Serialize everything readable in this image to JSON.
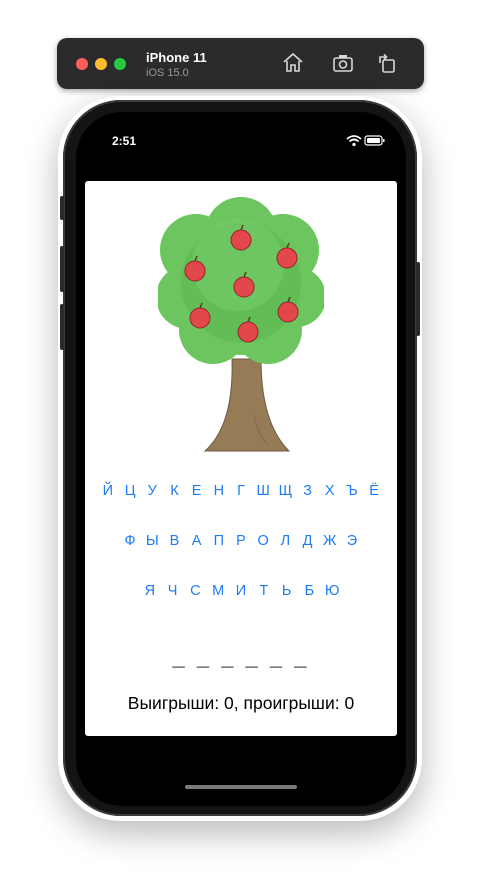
{
  "simulator": {
    "device_name": "iPhone 11",
    "os_version": "iOS 15.0",
    "controls": [
      "home-icon",
      "screenshot-icon",
      "rotate-icon"
    ]
  },
  "status_bar": {
    "time": "2:51",
    "icons": [
      "wifi-icon",
      "battery-icon"
    ]
  },
  "game": {
    "keyboard": {
      "row1": [
        "Й",
        "Ц",
        "У",
        "К",
        "Е",
        "Н",
        "Г",
        "Ш",
        "Щ",
        "З",
        "Х",
        "Ъ",
        "Ё"
      ],
      "row2": [
        "Ф",
        "Ы",
        "В",
        "А",
        "П",
        "Р",
        "О",
        "Л",
        "Д",
        "Ж",
        "Э"
      ],
      "row3": [
        "Я",
        "Ч",
        "С",
        "М",
        "И",
        "Т",
        "Ь",
        "Б",
        "Ю"
      ]
    },
    "word_display": "_ _ _ _ _ _",
    "score_text": "Выигрыши: 0, проигрыши: 0",
    "apples_remaining": 7
  },
  "colors": {
    "key_color": "#1e7cf6",
    "tree_foliage": "#6cc55f",
    "apple": "#e2474c",
    "trunk": "#957b56"
  }
}
